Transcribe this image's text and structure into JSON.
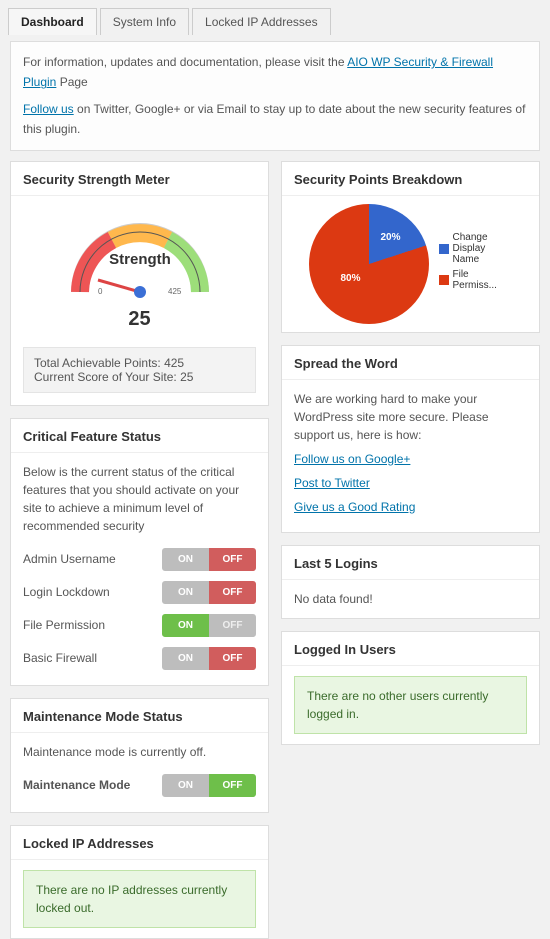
{
  "tabs": [
    {
      "label": "Dashboard",
      "active": true
    },
    {
      "label": "System Info",
      "active": false
    },
    {
      "label": "Locked IP Addresses",
      "active": false
    }
  ],
  "info": {
    "line1_prefix": "For information, updates and documentation, please visit the ",
    "line1_link": "AIO WP Security & Firewall Plugin",
    "line1_suffix": " Page",
    "line2_link": "Follow us",
    "line2_suffix": " on Twitter, Google+ or via Email to stay up to date about the new security features of this plugin."
  },
  "strength": {
    "title": "Security Strength Meter",
    "label": "Strength",
    "score": "25",
    "tick_left": "0",
    "tick_right": "425",
    "total_label": "Total Achievable Points: ",
    "total_value": "425",
    "current_label": "Current Score of Your Site: ",
    "current_value": "25"
  },
  "breakdown": {
    "title": "Security Points Breakdown",
    "slices": [
      {
        "name": "Change Display Name",
        "pct": "20%",
        "color": "#3366cc"
      },
      {
        "name": "File Permiss...",
        "pct": "80%",
        "color": "#dc3912"
      }
    ]
  },
  "critical": {
    "title": "Critical Feature Status",
    "desc": "Below is the current status of the critical features that you should activate on your site to achieve a minimum level of recommended security",
    "features": [
      {
        "name": "Admin Username",
        "state": "off"
      },
      {
        "name": "Login Lockdown",
        "state": "off"
      },
      {
        "name": "File Permission",
        "state": "on"
      },
      {
        "name": "Basic Firewall",
        "state": "off"
      }
    ],
    "on_label": "ON",
    "off_label": "OFF"
  },
  "spread": {
    "title": "Spread the Word",
    "desc": "We are working hard to make your WordPress site more secure. Please support us, here is how:",
    "links": [
      "Follow us on Google+",
      "Post to Twitter",
      "Give us a Good Rating"
    ]
  },
  "maintenance": {
    "title": "Maintenance Mode Status",
    "desc": "Maintenance mode is currently off.",
    "row_label": "Maintenance Mode",
    "on_label": "ON",
    "off_label": "OFF"
  },
  "logins": {
    "title": "Last 5 Logins",
    "msg": "No data found!"
  },
  "locked": {
    "title": "Locked IP Addresses",
    "msg": "There are no IP addresses currently locked out."
  },
  "loggedin": {
    "title": "Logged In Users",
    "msg": "There are no other users currently logged in."
  },
  "chart_data": {
    "type": "pie",
    "title": "Security Points Breakdown",
    "categories": [
      "Change Display Name",
      "File Permission"
    ],
    "values": [
      20,
      80
    ],
    "colors": [
      "#3366cc",
      "#dc3912"
    ]
  }
}
